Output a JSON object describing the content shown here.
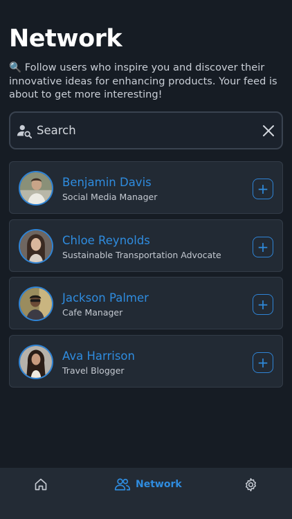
{
  "header": {
    "title": "Network",
    "subtitle": "🔍 Follow users who inspire you and discover their innovative ideas for enhancing products. Your feed is about to get more interesting!"
  },
  "search": {
    "placeholder": "Search",
    "value": ""
  },
  "users": [
    {
      "name": "Benjamin Davis",
      "role": "Social Media Manager",
      "action": "+"
    },
    {
      "name": "Chloe Reynolds",
      "role": "Sustainable Transportation Advocate",
      "action": "+"
    },
    {
      "name": "Jackson Palmer",
      "role": "Cafe Manager",
      "action": "+"
    },
    {
      "name": "Ava Harrison",
      "role": "Travel Blogger",
      "action": "+"
    }
  ],
  "nav": {
    "active": "network",
    "items": [
      {
        "id": "home",
        "icon": "home-icon",
        "label": ""
      },
      {
        "id": "network",
        "icon": "people-icon",
        "label": "Network"
      },
      {
        "id": "settings",
        "icon": "gear-icon",
        "label": ""
      }
    ]
  },
  "colors": {
    "background": "#161c24",
    "card": "#222a34",
    "accent": "#2f8cdf",
    "nav": "#232b35"
  }
}
